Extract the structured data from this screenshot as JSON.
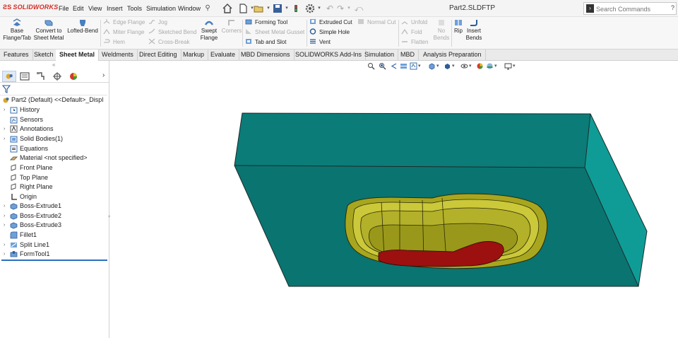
{
  "app": {
    "brand": "SOLIDWORKS",
    "document_title": "Part2.SLDFTP"
  },
  "menu": [
    "File",
    "Edit",
    "View",
    "Insert",
    "Tools",
    "Simulation",
    "Window"
  ],
  "search": {
    "placeholder": "Search Commands",
    "help_icon": "?"
  },
  "ribbon": {
    "base_flange": [
      "Base",
      "Flange/Tab"
    ],
    "convert": [
      "Convert to",
      "Sheet Metal"
    ],
    "lofted_bend": "Lofted-Bend",
    "edge_flange": "Edge Flange",
    "miter_flange": "Miter Flange",
    "hem": "Hem",
    "jog": "Jog",
    "sketched_bend": "Sketched Bend",
    "cross_break": "Cross-Break",
    "swept_flange": [
      "Swept",
      "Flange"
    ],
    "corners": "Corners",
    "forming_tool": "Forming Tool",
    "sheet_metal_gusset": "Sheet Metal Gusset",
    "tab_and_slot": "Tab and Slot",
    "extruded_cut": "Extruded Cut",
    "simple_hole": "Simple Hole",
    "vent": "Vent",
    "normal_cut": "Normal Cut",
    "unfold": "Unfold",
    "fold": "Fold",
    "flatten": "Flatten",
    "no_bends": [
      "No",
      "Bends"
    ],
    "rip": "Rip",
    "insert_bends": [
      "Insert",
      "Bends"
    ]
  },
  "tabs": [
    "Features",
    "Sketch",
    "Sheet Metal",
    "Weldments",
    "Direct Editing",
    "Markup",
    "Evaluate",
    "MBD Dimensions",
    "SOLIDWORKS Add-Ins",
    "Simulation",
    "MBD",
    "Analysis Preparation"
  ],
  "active_tab": "Sheet Metal",
  "tree": {
    "root": "Part2 (Default) <<Default>_Displ",
    "items": [
      {
        "label": "History",
        "icon": "history-folder-icon",
        "expandable": true
      },
      {
        "label": "Sensors",
        "icon": "sensor-icon",
        "expandable": false
      },
      {
        "label": "Annotations",
        "icon": "annotation-icon",
        "expandable": true
      },
      {
        "label": "Solid Bodies(1)",
        "icon": "solid-bodies-folder-icon",
        "expandable": true
      },
      {
        "label": "Equations",
        "icon": "equations-icon",
        "expandable": false
      },
      {
        "label": "Material <not specified>",
        "icon": "material-icon",
        "expandable": false
      },
      {
        "label": "Front Plane",
        "icon": "plane-icon",
        "expandable": false
      },
      {
        "label": "Top Plane",
        "icon": "plane-icon",
        "expandable": false
      },
      {
        "label": "Right Plane",
        "icon": "plane-icon",
        "expandable": false
      },
      {
        "label": "Origin",
        "icon": "origin-icon",
        "expandable": false
      },
      {
        "label": "Boss-Extrude1",
        "icon": "extrude-icon",
        "expandable": true
      },
      {
        "label": "Boss-Extrude2",
        "icon": "extrude-icon",
        "expandable": true
      },
      {
        "label": "Boss-Extrude3",
        "icon": "extrude-icon",
        "expandable": true
      },
      {
        "label": "Fillet1",
        "icon": "fillet-icon",
        "expandable": false
      },
      {
        "label": "Split Line1",
        "icon": "split-line-icon",
        "expandable": true
      },
      {
        "label": "FormTool1",
        "icon": "form-tool-icon",
        "expandable": true
      }
    ]
  },
  "colors": {
    "brand_red": "#d42b22",
    "block_top": "#0b7c78",
    "block_front": "#0a7470",
    "block_side": "#0f9c96",
    "form_yellow": "#a8a61e",
    "form_yellow_light": "#cbc83a",
    "face_red": "#9c1010",
    "rollback": "#2b6fbd"
  }
}
